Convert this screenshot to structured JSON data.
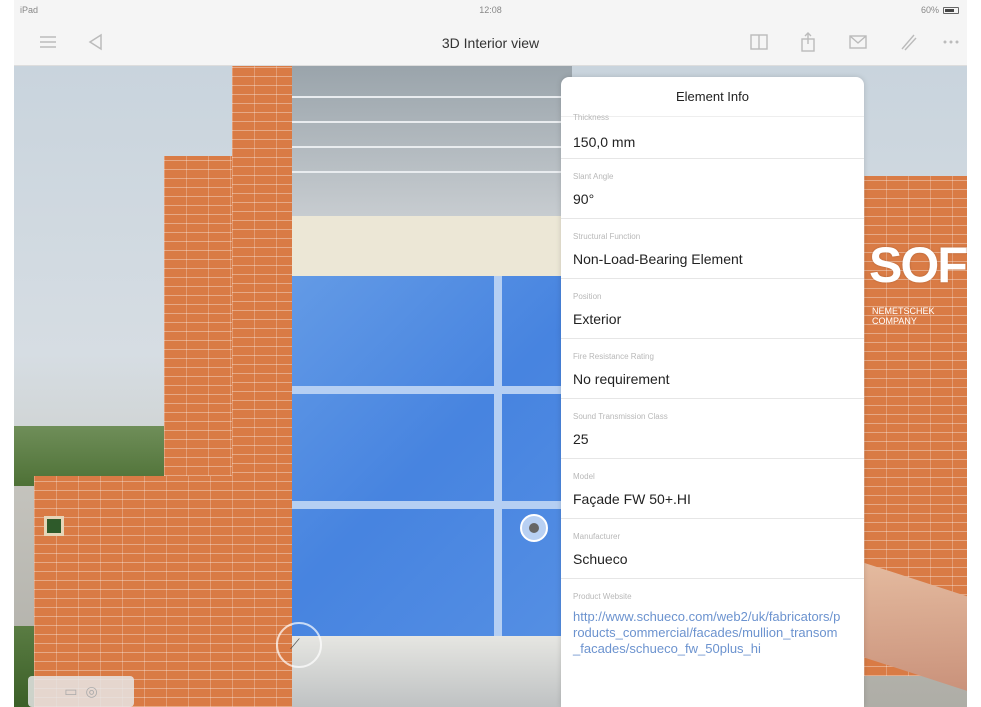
{
  "status_bar": {
    "device": "iPad",
    "time": "12:08",
    "battery": "60%"
  },
  "nav_bar": {
    "title": "3D Interior view",
    "icons": [
      "menu-icon",
      "back-icon",
      "book-icon",
      "share-icon",
      "mail-icon",
      "edit-icon",
      "more-icon"
    ]
  },
  "scene": {
    "logo_text": "SOFT",
    "logo_subtext": "NEMETSCHEK COMPANY",
    "mode_button_icons": [
      "floorplan-icon",
      "eye-icon"
    ]
  },
  "element_info": {
    "title": "Element Info",
    "first_row_label": "Thickness",
    "rows": [
      {
        "label": "Thickness",
        "value": "150,0 mm"
      },
      {
        "label": "Slant Angle",
        "value": "90°"
      },
      {
        "label": "Structural Function",
        "value": "Non-Load-Bearing Element"
      },
      {
        "label": "Position",
        "value": "Exterior"
      },
      {
        "label": "Fire Resistance Rating",
        "value": "No requirement"
      },
      {
        "label": "Sound Transmission Class",
        "value": "25"
      },
      {
        "label": "Model",
        "value": "Façade FW 50+.HI"
      },
      {
        "label": "Manufacturer",
        "value": "Schueco"
      },
      {
        "label": "Product Website",
        "value": "http://www.schueco.com/web2/uk/fabricators/products_commercial/facades/mullion_transom_facades/schueco_fw_50plus_hi"
      }
    ]
  },
  "colors": {
    "glass_selected": "#4a86e2",
    "brick": "#d97b45",
    "link": "#6c93cf"
  }
}
